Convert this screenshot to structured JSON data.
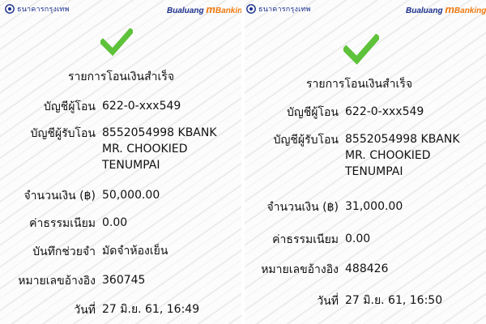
{
  "colors": {
    "check": "#5ec23a",
    "bank_blue": "#1b2f8c",
    "brand_orange": "#ee7a10"
  },
  "left": {
    "bank_name": "ธนาคารกรุงเทพ",
    "brand": {
      "part1": "Bualuang ",
      "part2": "m",
      "part3": "Banking"
    },
    "title": "รายการโอนเงินสำเร็จ",
    "from_label": "บัญชีผู้โอน",
    "from_value": "622-0-xxx549",
    "to_label": "บัญชีผู้รับโอน",
    "to_line1": "8552054998 KBANK",
    "to_line2": "MR. CHOOKIED",
    "to_line3": "TENUMPAI",
    "amount_label": "จำนวนเงิน (฿)",
    "amount_value": "50,000.00",
    "fee_label": "ค่าธรรมเนียม",
    "fee_value": "0.00",
    "memo_label": "บันทึกช่วยจำ",
    "memo_value": "มัดจำห้องเย็น",
    "ref_label": "หมายเลขอ้างอิง",
    "ref_value": "360745",
    "date_label": "วันที่",
    "date_value": "27 มิ.ย. 61, 16:49"
  },
  "right": {
    "bank_name": "ธนาคารกรุงเทพ",
    "brand": {
      "part1": "Bualuang ",
      "part2": "m",
      "part3": "Banking"
    },
    "title": "รายการโอนเงินสำเร็จ",
    "from_label": "บัญชีผู้โอน",
    "from_value": "622-0-xxx549",
    "to_label": "บัญชีผู้รับโอน",
    "to_line1": "8552054998 KBANK",
    "to_line2": "MR. CHOOKIED",
    "to_line3": "TENUMPAI",
    "amount_label": "จำนวนเงิน (฿)",
    "amount_value": "31,000.00",
    "fee_label": "ค่าธรรมเนียม",
    "fee_value": "0.00",
    "ref_label": "หมายเลขอ้างอิง",
    "ref_value": "488426",
    "date_label": "วันที่",
    "date_value": "27 มิ.ย. 61, 16:50"
  }
}
